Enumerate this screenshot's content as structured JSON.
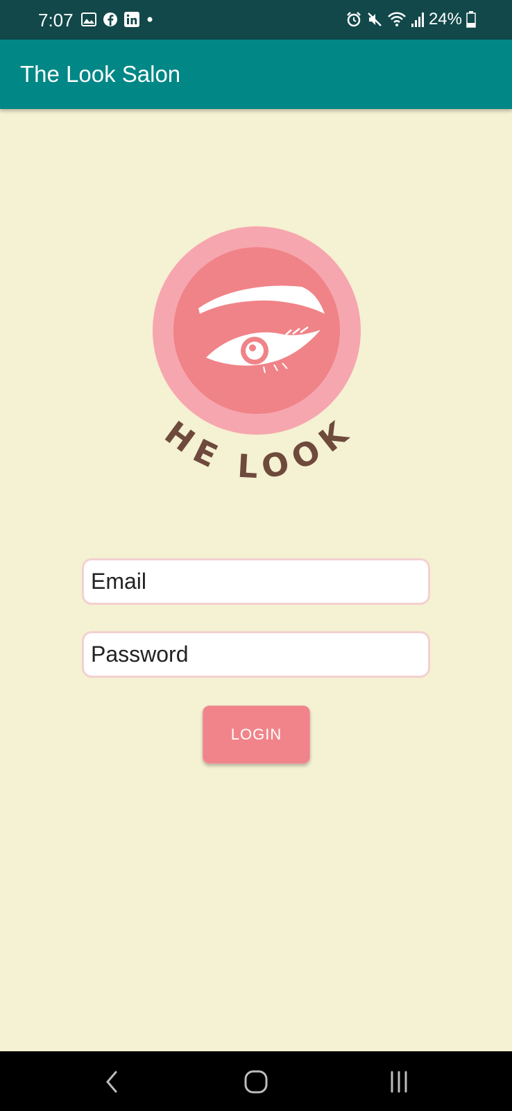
{
  "status_bar": {
    "time": "7:07",
    "battery": "24%",
    "left_icons": [
      "gallery-icon",
      "facebook-icon",
      "linkedin-icon",
      "notification-dot-icon"
    ],
    "right_icons": [
      "alarm-icon",
      "mute-icon",
      "wifi-icon",
      "signal-icon",
      "battery-icon"
    ]
  },
  "app_bar": {
    "title": "The Look Salon"
  },
  "logo": {
    "text": "THE LOOK!",
    "colors": {
      "outer_circle": "#f6a6ae",
      "inner_circle": "#f08388",
      "text": "#6e4a3c"
    }
  },
  "form": {
    "email_placeholder": "Email",
    "password_placeholder": "Password",
    "login_label": "LOGIN"
  },
  "colors": {
    "status_bar": "#12484a",
    "app_bar": "#008786",
    "background": "#f5f1d3",
    "button": "#f0848a",
    "field_border": "#f4d0d0"
  },
  "nav_bar": {
    "buttons": [
      "back-icon",
      "home-icon",
      "recents-icon"
    ]
  }
}
